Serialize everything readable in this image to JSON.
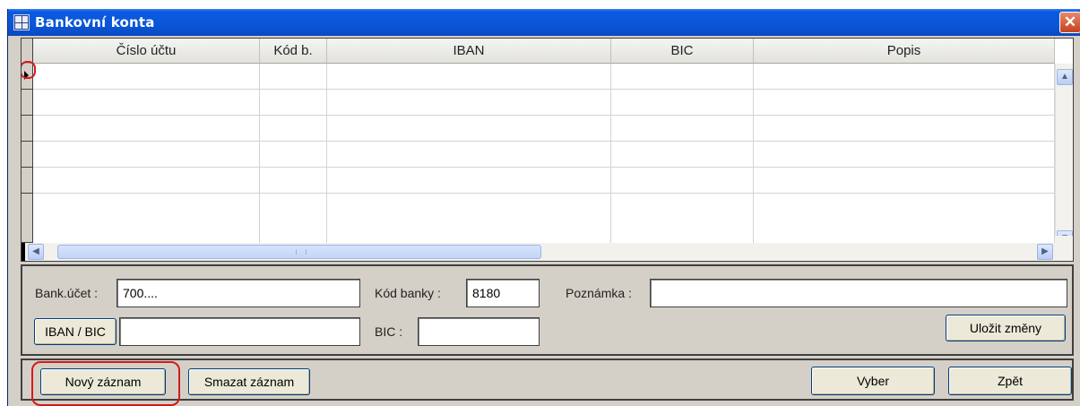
{
  "window": {
    "title": "Bankovní konta",
    "close_glyph": "✕"
  },
  "grid": {
    "columns": [
      "Číslo účtu",
      "Kód b.",
      "IBAN",
      "BIC",
      "Popis"
    ],
    "rows": [
      [
        "",
        "",
        "",
        "",
        ""
      ],
      [
        "",
        "",
        "",
        "",
        ""
      ],
      [
        "",
        "",
        "",
        "",
        ""
      ],
      [
        "",
        "",
        "",
        "",
        ""
      ],
      [
        "",
        "",
        "",
        "",
        ""
      ]
    ]
  },
  "form": {
    "bank_account_label": "Bank.účet :",
    "bank_account_value": "700....",
    "bank_code_label": "Kód banky :",
    "bank_code_value": "8180",
    "note_label": "Poznámka :",
    "note_value": "",
    "iban_button": "IBAN / BIC",
    "iban_value": "",
    "bic_label": "BIC :",
    "bic_value": "",
    "save_button": "Uložit změny"
  },
  "actions": {
    "new_record": "Nový záznam",
    "delete_record": "Smazat záznam",
    "select": "Vyber",
    "back": "Zpět"
  },
  "colors": {
    "titlebar": "#0a56d8",
    "highlight": "#d41a1a",
    "panel": "#d4d0c8"
  },
  "icons": [
    "app-icon",
    "close-icon",
    "row-pointer-icon",
    "scroll-up-icon",
    "scroll-down-icon",
    "scroll-left-icon",
    "scroll-right-icon"
  ]
}
